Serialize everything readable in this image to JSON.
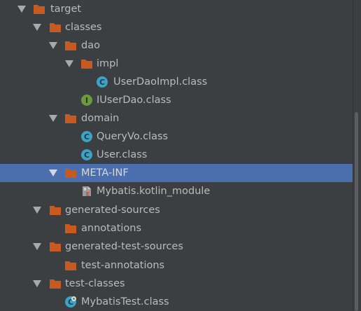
{
  "colors": {
    "background": "#3c3f41",
    "selection": "#4b6eaf",
    "text": "#bbbbbb",
    "folder": "#c75a1e",
    "class_icon": "#3da3c6",
    "interface_icon": "#6a9a3c"
  },
  "tree": {
    "items": [
      {
        "label": "target",
        "icon": "folder-icon",
        "expanded": true
      },
      {
        "label": "classes",
        "icon": "folder-icon",
        "expanded": true
      },
      {
        "label": "dao",
        "icon": "folder-icon",
        "expanded": true
      },
      {
        "label": "impl",
        "icon": "folder-icon",
        "expanded": true
      },
      {
        "label": "UserDaoImpl.class",
        "icon": "class-icon"
      },
      {
        "label": "IUserDao.class",
        "icon": "interface-icon"
      },
      {
        "label": "domain",
        "icon": "folder-icon",
        "expanded": true
      },
      {
        "label": "QueryVo.class",
        "icon": "class-icon"
      },
      {
        "label": "User.class",
        "icon": "class-icon"
      },
      {
        "label": "META-INF",
        "icon": "folder-icon",
        "expanded": true,
        "selected": true
      },
      {
        "label": "Mybatis.kotlin_module",
        "icon": "kotlin-module-icon"
      },
      {
        "label": "generated-sources",
        "icon": "folder-icon",
        "expanded": true
      },
      {
        "label": "annotations",
        "icon": "folder-icon"
      },
      {
        "label": "generated-test-sources",
        "icon": "folder-icon",
        "expanded": true
      },
      {
        "label": "test-annotations",
        "icon": "folder-icon"
      },
      {
        "label": "test-classes",
        "icon": "folder-icon",
        "expanded": true
      },
      {
        "label": "MybatisTest.class",
        "icon": "test-class-icon"
      }
    ]
  }
}
